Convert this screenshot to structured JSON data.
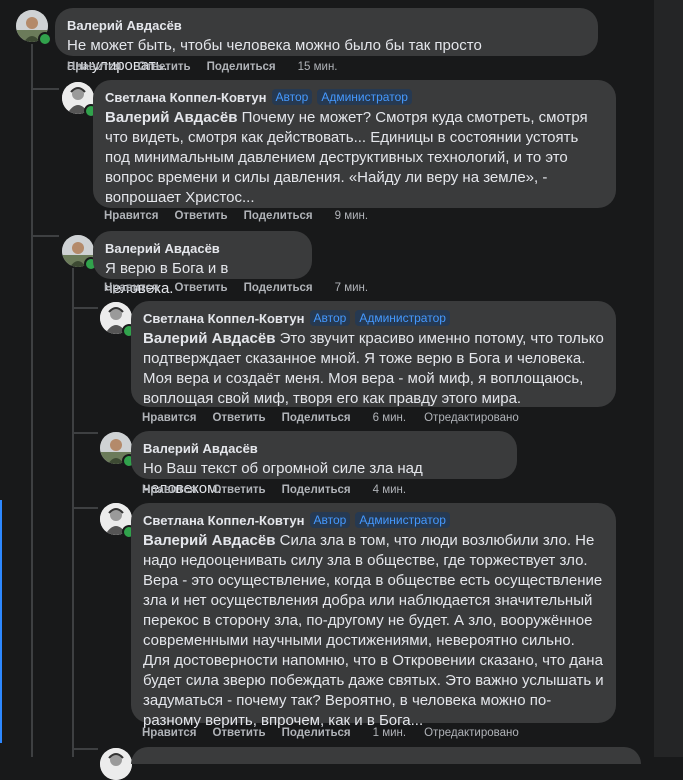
{
  "actions": {
    "like": "Нравится",
    "reply": "Ответить",
    "share": "Поделиться",
    "edited": "Отредактировано"
  },
  "badges": {
    "author": "Автор",
    "admin": "Администратор"
  },
  "comments": [
    {
      "author": "Валерий Авдасёв",
      "mention": "",
      "text": "Не может быть, чтобы человека можно было бы так просто аннулировать.",
      "time": "15 мин."
    },
    {
      "author": "Светлана Коппел-Ковтун",
      "mention": "Валерий Авдасёв",
      "text": "Почему не может? Смотря куда смотреть, смотря что видеть, смотря как действовать... Единицы в состоянии устоять под минимальным давлением деструктивных технологий, и то это вопрос времени и силы давления. «Найду ли веру на земле», - вопрошает Христос...",
      "time": "9 мин."
    },
    {
      "author": "Валерий Авдасёв",
      "mention": "",
      "text": "Я верю в Бога и в человека.",
      "time": "7 мин."
    },
    {
      "author": "Светлана Коппел-Ковтун",
      "mention": "Валерий Авдасёв",
      "text": "Это звучит красиво именно потому, что только подтверждает сказанное мной. Я тоже верю в Бога и человека. Моя вера и создаёт меня. Моя вера - мой миф, я воплощаюсь, воплощая свой миф, творя его как правду этого мира.",
      "time": "6 мин."
    },
    {
      "author": "Валерий Авдасёв",
      "mention": "",
      "text": "Но Ваш текст об огромной силе зла над человеком.",
      "time": "4 мин."
    },
    {
      "author": "Светлана Коппел-Ковтун",
      "mention": "Валерий Авдасёв",
      "text": "Сила зла в том, что люди возлюбили зло. Не надо недооценивать силу зла в обществе, где торжествует зло. Вера - это осуществление, когда в обществе есть осуществление зла и нет осуществления добра или наблюдается значительный перекос в сторону зла, по-другому не будет. А зло, вооружённое современными научными достижениями, невероятно сильно. Для достоверности напомню, что в Откровении сказано, что дана будет сила зверю побеждать даже святых. Это важно услышать и задуматься - почему так? Вероятно, в человека можно по-разному верить, впрочем, как и в Бога...",
      "time": "1 мин."
    }
  ]
}
